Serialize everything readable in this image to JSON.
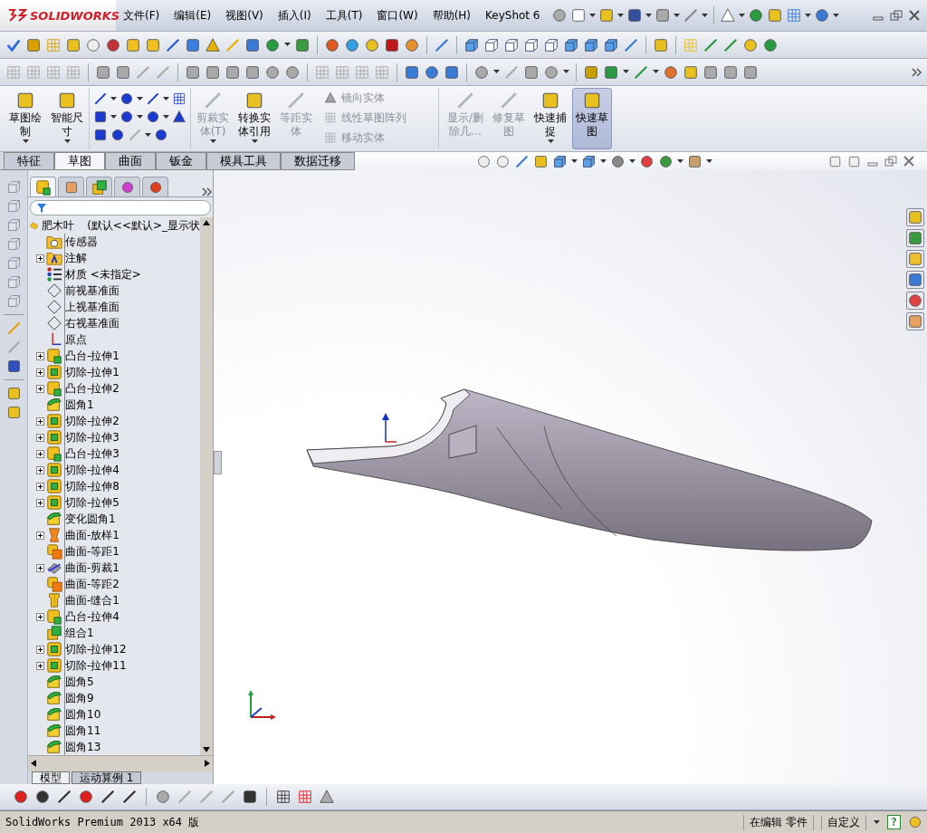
{
  "window": {
    "logo": "SOLIDWORKS",
    "menus": [
      "文件(F)",
      "编辑(E)",
      "视图(V)",
      "插入(I)",
      "工具(T)",
      "窗口(W)",
      "帮助(H)",
      "KeyShot 6"
    ]
  },
  "ribbon": {
    "items": [
      {
        "kind": "large",
        "lines": [
          "草图绘",
          "制"
        ],
        "disabled": false,
        "on": false,
        "dropdown": true
      },
      {
        "kind": "large",
        "lines": [
          "智能尺",
          "寸"
        ],
        "disabled": false,
        "on": false,
        "dropdown": true
      },
      {
        "kind": "tools"
      },
      {
        "kind": "large",
        "lines": [
          "剪裁实",
          "体(T)"
        ],
        "disabled": true,
        "on": false,
        "dropdown": true
      },
      {
        "kind": "large",
        "lines": [
          "转换实",
          "体引用"
        ],
        "disabled": false,
        "on": false,
        "dropdown": true
      },
      {
        "kind": "large",
        "lines": [
          "等距实",
          "体"
        ],
        "disabled": true,
        "on": false,
        "dropdown": false
      },
      {
        "kind": "list",
        "entries": [
          {
            "label": "镜向实体",
            "disabled": true
          },
          {
            "label": "线性草图阵列",
            "disabled": true
          },
          {
            "label": "移动实体",
            "disabled": true
          }
        ]
      },
      {
        "kind": "large",
        "lines": [
          "显示/删",
          "除几…"
        ],
        "disabled": true,
        "on": false,
        "dropdown": false
      },
      {
        "kind": "large",
        "lines": [
          "修复草",
          "图"
        ],
        "disabled": true,
        "on": false,
        "dropdown": false
      },
      {
        "kind": "large",
        "lines": [
          "快速捕",
          "捉"
        ],
        "disabled": false,
        "on": false,
        "dropdown": true
      },
      {
        "kind": "large",
        "lines": [
          "快速草",
          "图"
        ],
        "disabled": false,
        "on": true,
        "dropdown": false
      }
    ]
  },
  "tabs": [
    {
      "label": "特征",
      "selected": false
    },
    {
      "label": "草图",
      "selected": true
    },
    {
      "label": "曲面",
      "selected": false
    },
    {
      "label": "钣金",
      "selected": false
    },
    {
      "label": "模具工具",
      "selected": false
    },
    {
      "label": "数据迁移",
      "selected": false
    }
  ],
  "feature_manager": {
    "panel_tabs": [
      {
        "selected": true
      },
      {
        "selected": false
      },
      {
        "selected": false
      },
      {
        "selected": false
      },
      {
        "selected": false
      }
    ],
    "root": {
      "name": "肥木叶",
      "configuration": "(默认<<默认>_显示状"
    },
    "items": [
      {
        "label": "传感器",
        "kind": "sensors",
        "expandable": false
      },
      {
        "label": "注解",
        "kind": "annotations",
        "expandable": true
      },
      {
        "label": "材质 <未指定>",
        "kind": "material",
        "expandable": false
      },
      {
        "label": "前视基准面",
        "kind": "plane",
        "expandable": false
      },
      {
        "label": "上视基准面",
        "kind": "plane",
        "expandable": false
      },
      {
        "label": "右视基准面",
        "kind": "plane",
        "expandable": false
      },
      {
        "label": "原点",
        "kind": "origin",
        "expandable": false
      },
      {
        "label": "凸台-拉伸1",
        "kind": "boss",
        "expandable": true
      },
      {
        "label": "切除-拉伸1",
        "kind": "cut",
        "expandable": true
      },
      {
        "label": "凸台-拉伸2",
        "kind": "boss",
        "expandable": true
      },
      {
        "label": "圆角1",
        "kind": "fillet",
        "expandable": false
      },
      {
        "label": "切除-拉伸2",
        "kind": "cut",
        "expandable": true
      },
      {
        "label": "切除-拉伸3",
        "kind": "cut",
        "expandable": true
      },
      {
        "label": "凸台-拉伸3",
        "kind": "boss",
        "expandable": true
      },
      {
        "label": "切除-拉伸4",
        "kind": "cut",
        "expandable": true
      },
      {
        "label": "切除-拉伸8",
        "kind": "cut",
        "expandable": true
      },
      {
        "label": "切除-拉伸5",
        "kind": "cut",
        "expandable": true
      },
      {
        "label": "变化圆角1",
        "kind": "fillet",
        "expandable": false
      },
      {
        "label": "曲面-放样1",
        "kind": "loft",
        "expandable": true
      },
      {
        "label": "曲面-等距1",
        "kind": "offset",
        "expandable": false
      },
      {
        "label": "曲面-剪裁1",
        "kind": "trim",
        "expandable": true
      },
      {
        "label": "曲面-等距2",
        "kind": "offset",
        "expandable": false
      },
      {
        "label": "曲面-缝合1",
        "kind": "knit",
        "expandable": false
      },
      {
        "label": "凸台-拉伸4",
        "kind": "boss",
        "expandable": true
      },
      {
        "label": "组合1",
        "kind": "combine",
        "expandable": false
      },
      {
        "label": "切除-拉伸12",
        "kind": "cut",
        "expandable": true
      },
      {
        "label": "切除-拉伸11",
        "kind": "cut",
        "expandable": true
      },
      {
        "label": "圆角5",
        "kind": "fillet",
        "expandable": false
      },
      {
        "label": "圆角9",
        "kind": "fillet",
        "expandable": false
      },
      {
        "label": "圆角10",
        "kind": "fillet",
        "expandable": false
      },
      {
        "label": "圆角11",
        "kind": "fillet",
        "expandable": false
      },
      {
        "label": "圆角13",
        "kind": "fillet",
        "expandable": false
      }
    ],
    "bottom_tabs": [
      {
        "label": "模型",
        "selected": true
      },
      {
        "label": "运动算例 1",
        "selected": false
      }
    ]
  },
  "status_bar": {
    "product": "SolidWorks Premium 2013 x64 版",
    "mode": "在编辑 零件",
    "units": "自定义",
    "help": "?"
  }
}
